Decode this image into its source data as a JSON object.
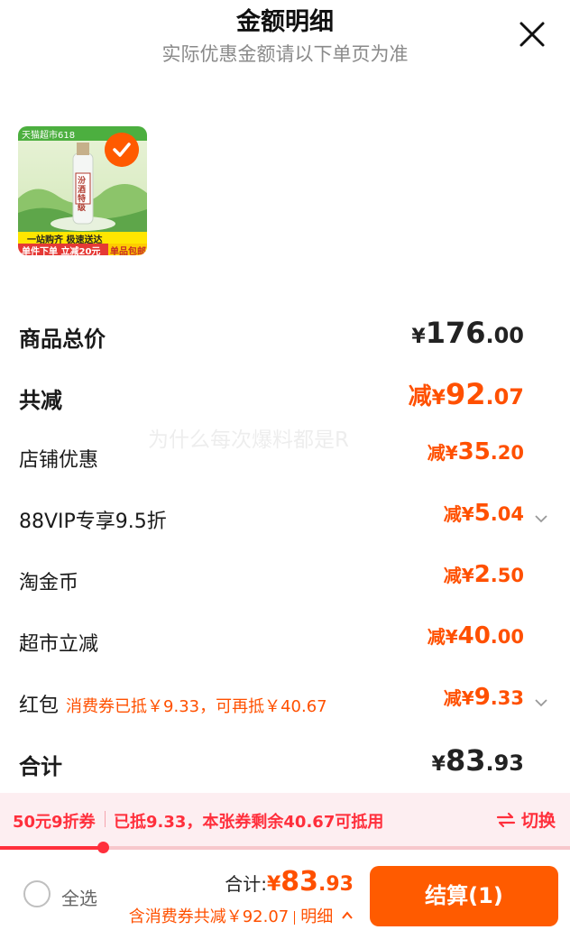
{
  "header": {
    "title": "金额明细",
    "subtitle": "实际优惠金额请以下单页为准"
  },
  "product": {
    "badge_text": "天猫超市618",
    "banner_line1": "一站购齐 极速送达",
    "banner_line2": "单件下单 立减20元",
    "banner_tag": "单品包邮",
    "bottle_label": "汾酒特级"
  },
  "rows": [
    {
      "label": "商品总价",
      "prefix": "",
      "currency": "¥",
      "int": "176",
      "dec": ".00",
      "style": "black"
    },
    {
      "label": "共减",
      "prefix": "减",
      "currency": "¥",
      "int": "92",
      "dec": ".07",
      "style": "orange"
    },
    {
      "label": "店铺优惠",
      "prefix": "减",
      "currency": "¥",
      "int": "35",
      "dec": ".20",
      "style": "orange"
    },
    {
      "label": "88VIP专享9.5折",
      "prefix": "减",
      "currency": "¥",
      "int": "5",
      "dec": ".04",
      "style": "orange"
    },
    {
      "label": "淘金币",
      "prefix": "减",
      "currency": "¥",
      "int": "2",
      "dec": ".50",
      "style": "orange"
    },
    {
      "label": "超市立减",
      "prefix": "减",
      "currency": "¥",
      "int": "40",
      "dec": ".00",
      "style": "orange"
    },
    {
      "label": "红包",
      "note": "消费券已抵￥9.33，可再抵￥40.67",
      "prefix": "减",
      "currency": "¥",
      "int": "9",
      "dec": ".33",
      "style": "orange"
    },
    {
      "label": "合计",
      "prefix": "",
      "currency": "¥",
      "int": "83",
      "dec": ".93",
      "style": "black"
    }
  ],
  "watermark": "为什么每次爆料都是R",
  "coupon": {
    "tag": "50元9折券",
    "desc": "已抵9.33，本张券剩余40.67可抵用",
    "switch_label": "切换",
    "used_fraction": 0.18
  },
  "footer": {
    "select_all": "全选",
    "total_label": "合计:",
    "total_currency": "¥",
    "total_int": "83",
    "total_dec": ".93",
    "detail_text": "含消费券共减￥92.07",
    "detail_link": "明细",
    "checkout": "结算(1)"
  },
  "colors": {
    "accent": "#ff5000",
    "coupon_red": "#ff2f3c",
    "checkout_bg": "#ff5b00"
  }
}
